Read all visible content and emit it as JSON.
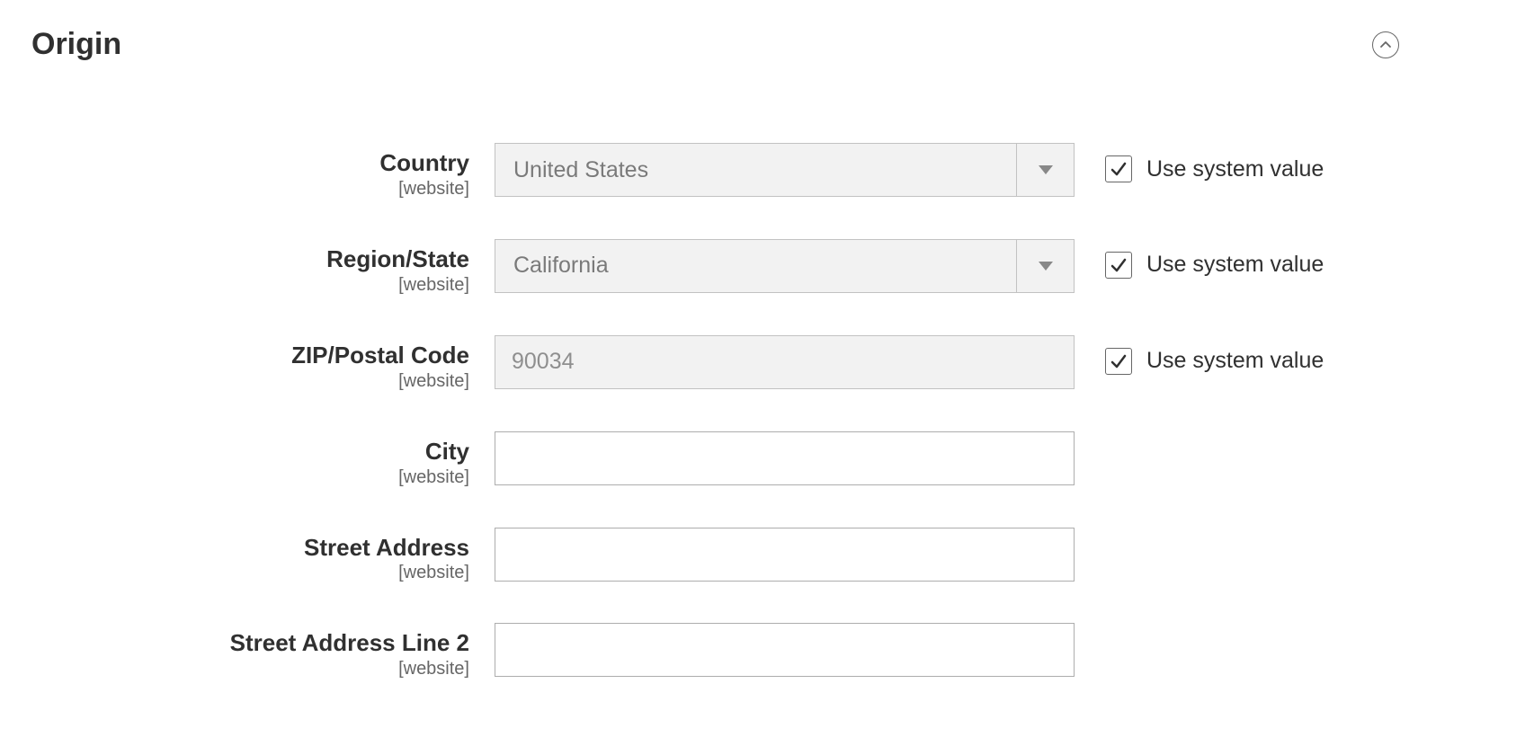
{
  "section": {
    "title": "Origin"
  },
  "labels": {
    "scope": "[website]",
    "use_system_value": "Use system value"
  },
  "fields": {
    "country": {
      "label": "Country",
      "value": "United States",
      "use_system": true
    },
    "region": {
      "label": "Region/State",
      "value": "California",
      "use_system": true
    },
    "zip": {
      "label": "ZIP/Postal Code",
      "value": "90034",
      "use_system": true
    },
    "city": {
      "label": "City",
      "value": ""
    },
    "street1": {
      "label": "Street Address",
      "value": ""
    },
    "street2": {
      "label": "Street Address Line 2",
      "value": ""
    }
  }
}
